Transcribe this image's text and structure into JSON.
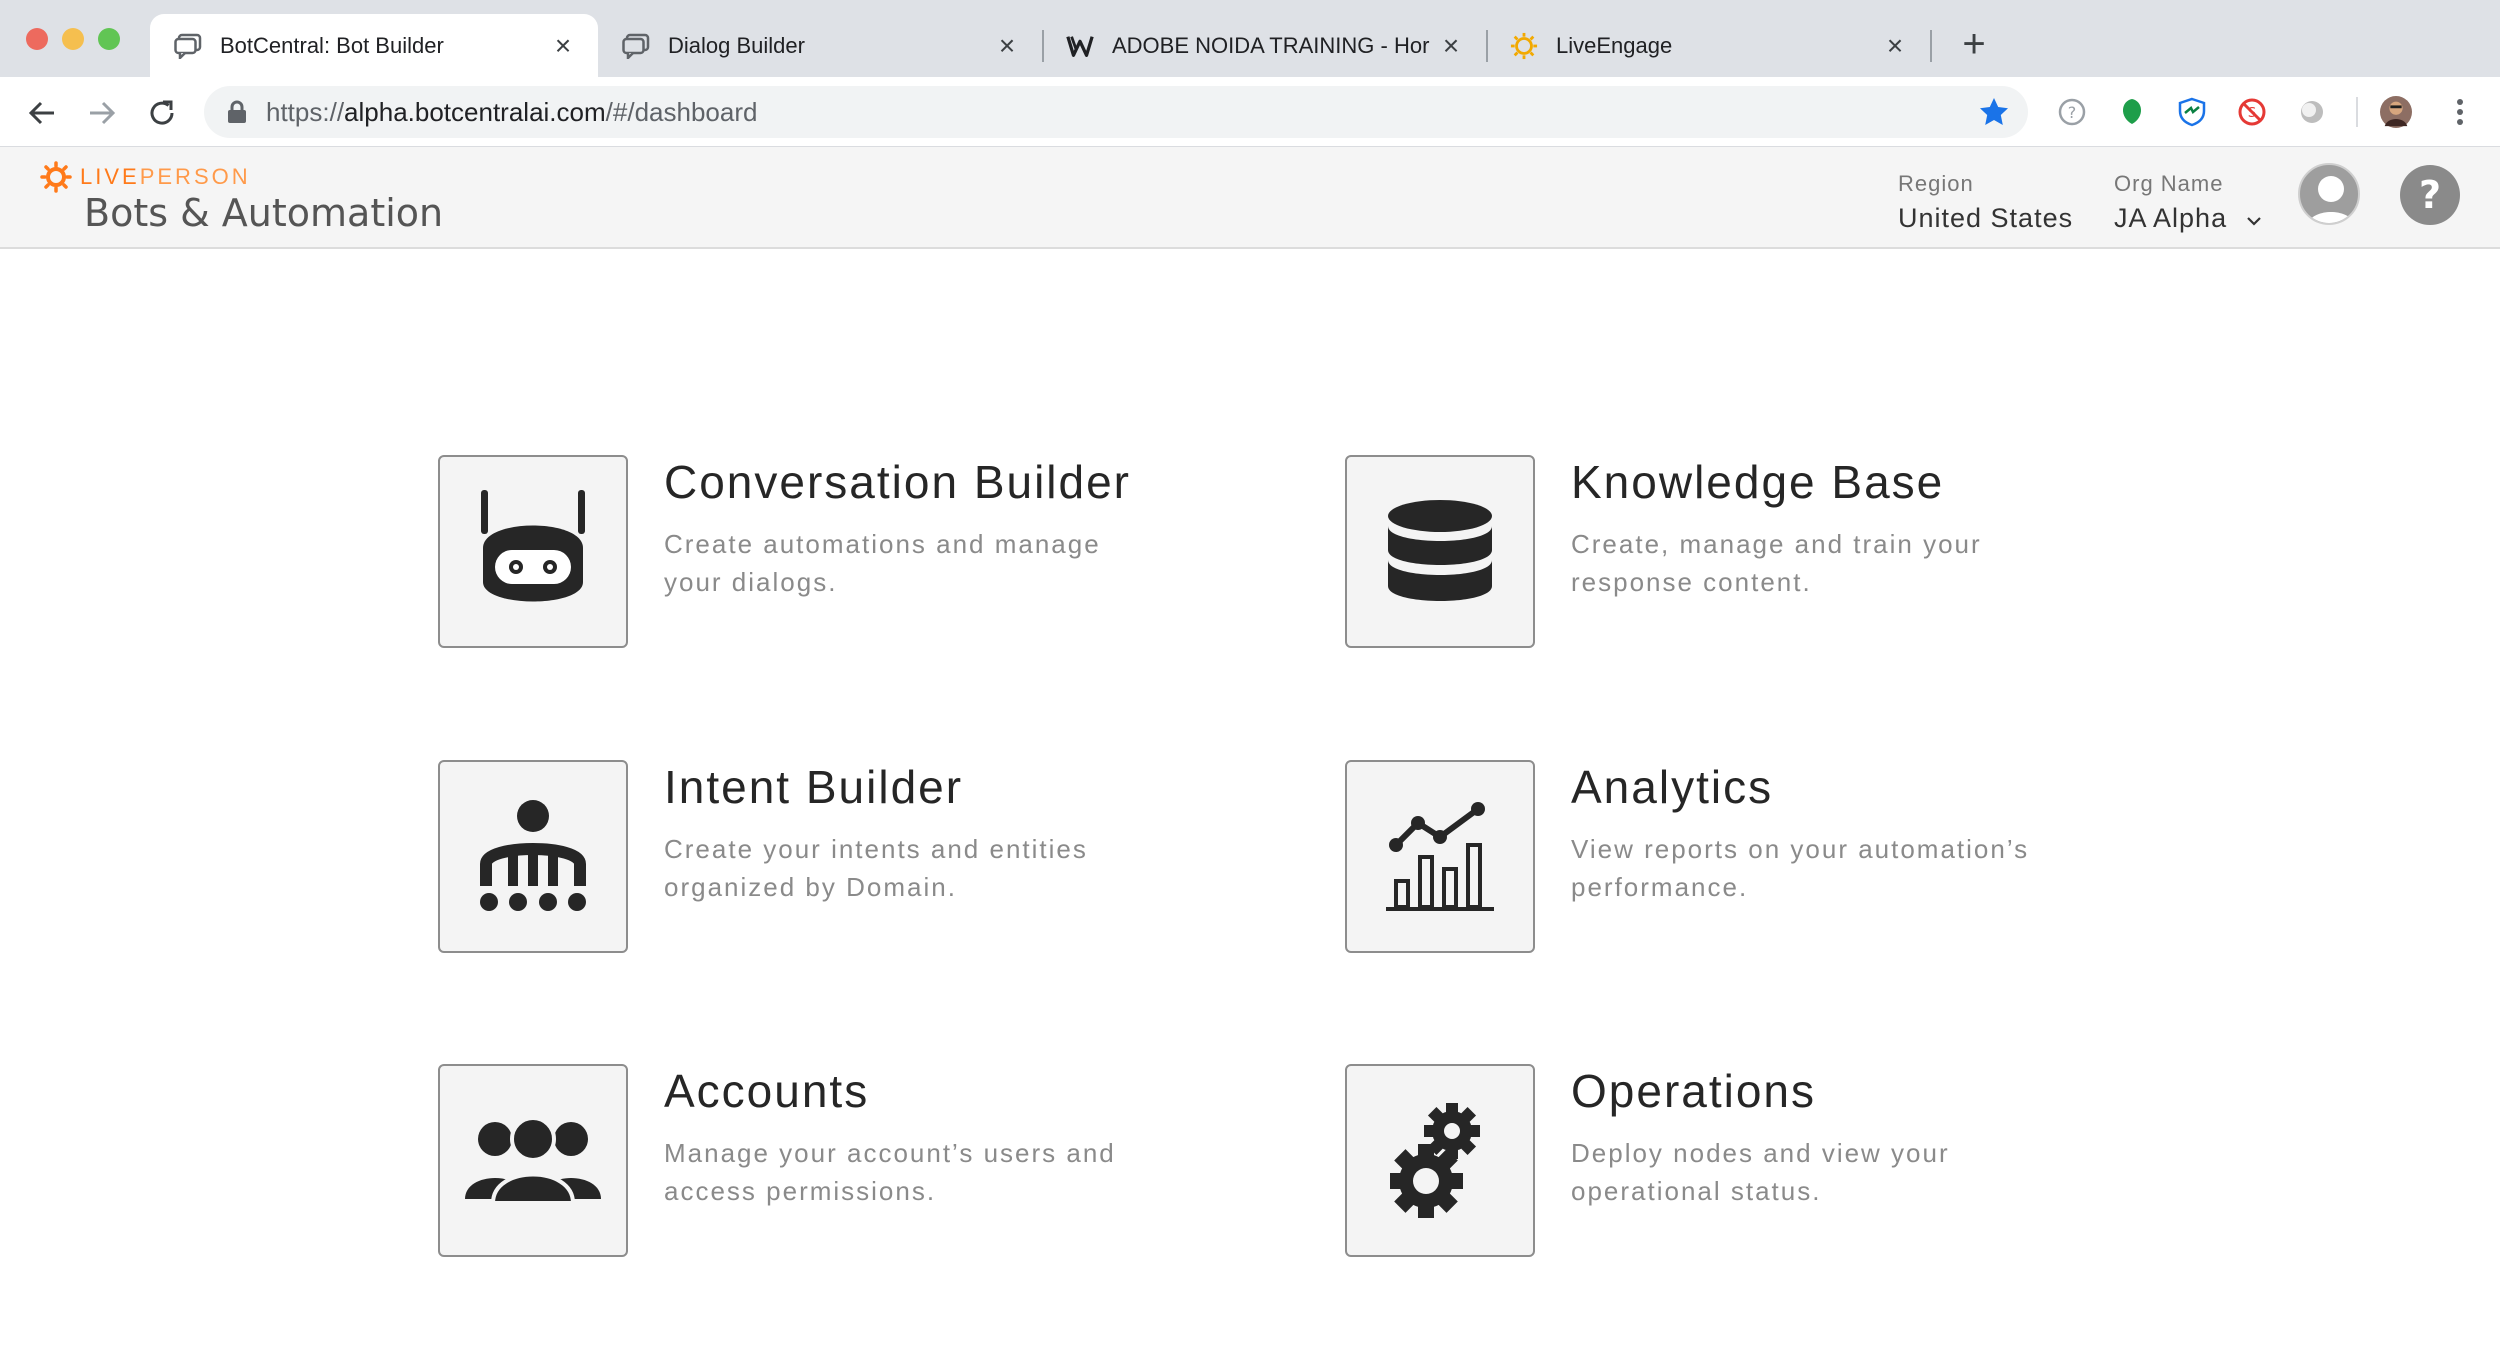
{
  "browser": {
    "tabs": [
      {
        "title": "BotCentral: Bot Builder",
        "icon": "chat-bubble-icon",
        "active": true
      },
      {
        "title": "Dialog Builder",
        "icon": "chat-bubble-icon",
        "active": false
      },
      {
        "title": "ADOBE NOIDA TRAINING - Hor",
        "icon": "w-logo-icon",
        "active": false
      },
      {
        "title": "LiveEngage",
        "icon": "sun-logo-icon",
        "active": false
      }
    ],
    "url_prefix": "https://",
    "url_host": "alpha.botcentralai.com",
    "url_path": "/#/dashboard",
    "star_color": "#1a73e8"
  },
  "header": {
    "brand_bold": "LIVE",
    "brand_light": "PERSON",
    "brand_color": "#ff7a1a",
    "product": "Bots & Automation",
    "region_label": "Region",
    "region_value": "United States",
    "org_label": "Org Name",
    "org_value": "JA Alpha",
    "help_label": "?"
  },
  "cards": [
    {
      "title": "Conversation Builder",
      "desc": "Create automations and manage your dialogs.",
      "icon": "robot-icon"
    },
    {
      "title": "Knowledge Base",
      "desc": "Create, manage and train your response content.",
      "icon": "database-icon"
    },
    {
      "title": "Intent Builder",
      "desc": "Create your intents and entities organized by Domain.",
      "icon": "intent-tree-icon"
    },
    {
      "title": "Analytics",
      "desc": "View reports on your automation’s performance.",
      "icon": "analytics-chart-icon"
    },
    {
      "title": "Accounts",
      "desc": "Manage your account’s users and access permissions.",
      "icon": "users-group-icon"
    },
    {
      "title": "Operations",
      "desc": "Deploy nodes and view your operational status.",
      "icon": "gears-icon"
    }
  ]
}
